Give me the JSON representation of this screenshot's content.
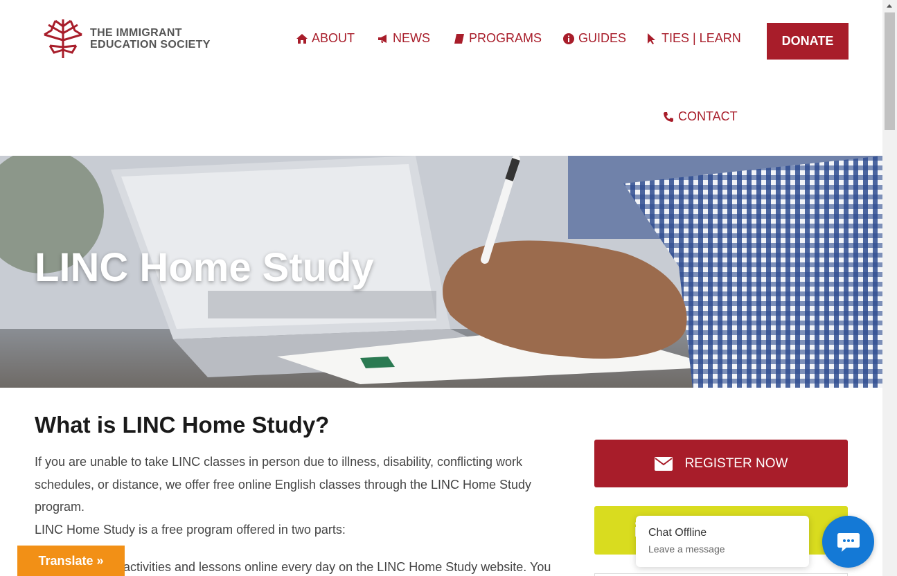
{
  "header": {
    "logo_line1": "THE IMMIGRANT",
    "logo_line2": "EDUCATION SOCIETY",
    "nav": {
      "about": "ABOUT",
      "news": "NEWS",
      "programs": "PROGRAMS",
      "guides": "GUIDES",
      "ties": "TIES | LEARN",
      "contact": "CONTACT"
    },
    "donate": "DONATE"
  },
  "hero": {
    "title": "LINC Home Study"
  },
  "main": {
    "heading": "What is LINC Home Study?",
    "para1": "If you are unable to take LINC classes in person due to illness, disability, conflicting work schedules, or distance, we offer free online English classes through the LINC Home Study program.",
    "para2": "LINC Home Study is a free program offered in two parts:",
    "para3": "activities and lessons online every day on the LINC Home Study website. You"
  },
  "sidebar": {
    "register": "REGISTER NOW"
  },
  "chat": {
    "status": "Chat Offline",
    "prompt": "Leave a message"
  },
  "translate": {
    "label": "Translate »"
  },
  "colors": {
    "brand_red": "#a81d2a",
    "chat_blue": "#1479d6",
    "translate_orange": "#f29016",
    "yellow": "#d9dc1f"
  }
}
